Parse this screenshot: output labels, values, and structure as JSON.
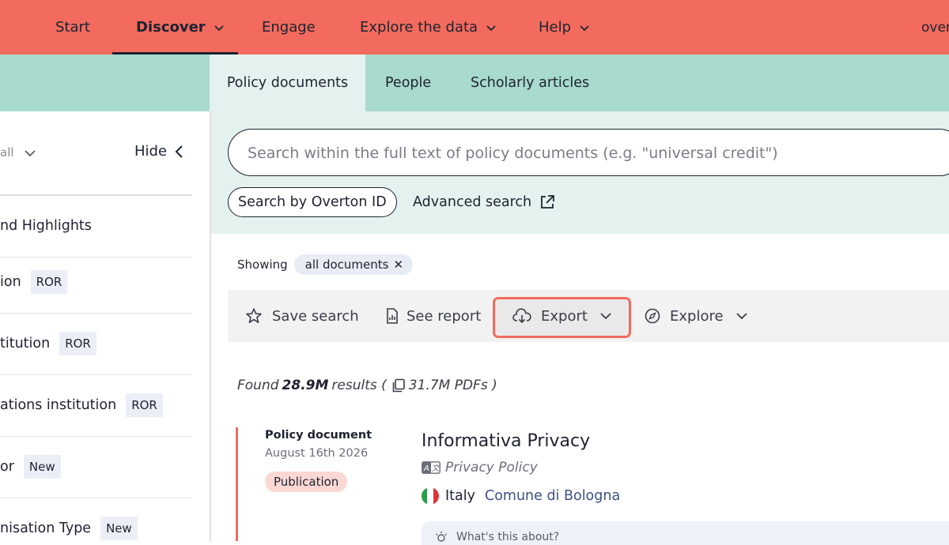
{
  "nav": {
    "items": [
      {
        "label": "Start"
      },
      {
        "label": "Discover"
      },
      {
        "label": "Engage"
      },
      {
        "label": "Explore the data"
      },
      {
        "label": "Help"
      }
    ],
    "user": "over"
  },
  "tabs": [
    {
      "label": "Policy documents"
    },
    {
      "label": "People"
    },
    {
      "label": "Scholarly articles"
    }
  ],
  "sidebar": {
    "filter_label": "all",
    "hide_label": "Hide",
    "items": [
      {
        "label": "nd Highlights",
        "badge": ""
      },
      {
        "label": "ion",
        "badge": "ROR"
      },
      {
        "label": "titution",
        "badge": "ROR"
      },
      {
        "label": "ations institution",
        "badge": "ROR"
      },
      {
        "label": "or",
        "badge": "New"
      },
      {
        "label": "nisation Type",
        "badge": "New"
      }
    ]
  },
  "search": {
    "placeholder": "Search within the full text of policy documents (e.g. \"universal credit\")",
    "overton_id_label": "Search by Overton ID",
    "advanced_label": "Advanced search"
  },
  "showing": {
    "label": "Showing",
    "chip": "all documents"
  },
  "toolbar": {
    "save": "Save search",
    "report": "See report",
    "export": "Export",
    "explore": "Explore"
  },
  "results": {
    "found_prefix": "Found",
    "count": "28.9M",
    "found_mid": "results (",
    "pdfs": "31.7M PDFs )",
    "item": {
      "type": "Policy document",
      "date": "August 16th 2026",
      "tag": "Publication",
      "title": "Informativa Privacy",
      "subtitle": "Privacy Policy",
      "country": "Italy",
      "source": "Comune di Bologna",
      "about": "What's this about?"
    }
  },
  "colors": {
    "brand": "#f26b5e",
    "teal": "#a8dacd",
    "teal_light": "#e3f2ee"
  }
}
